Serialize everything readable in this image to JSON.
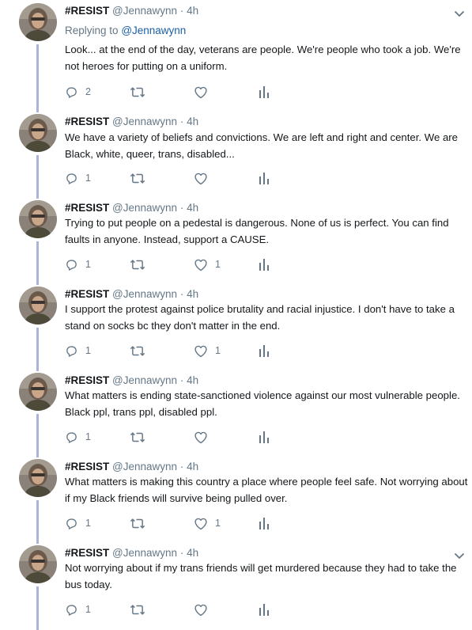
{
  "colors": {
    "text": "#14171a",
    "secondary": "#657786",
    "link": "#1b5fa8",
    "thread_line": "#aab3dc",
    "icon": "#657786"
  },
  "icons": {
    "reply": "speech-bubble",
    "retweet": "retweet-arrows",
    "like": "heart-outline",
    "analytics": "bar-chart",
    "more": "chevron-down"
  },
  "tweets": [
    {
      "display_name": "#RESIST",
      "handle": "@Jennawynn",
      "dot": "·",
      "time": "4h",
      "replying_label": "Replying to",
      "replying_to": "@Jennawynn",
      "text": "Look... at the end of the day, veterans are people. We're people who took a job. We're not heroes for putting on a uniform.",
      "reply_count": "2",
      "retweet_count": "",
      "like_count": ""
    },
    {
      "display_name": "#RESIST",
      "handle": "@Jennawynn",
      "dot": "·",
      "time": "4h",
      "text": "We have a variety of beliefs and convictions. We are left and right and center. We are Black, white, queer, trans, disabled...",
      "reply_count": "1",
      "retweet_count": "",
      "like_count": ""
    },
    {
      "display_name": "#RESIST",
      "handle": "@Jennawynn",
      "dot": "·",
      "time": "4h",
      "text": "Trying to put people on a pedestal is dangerous. None of us is perfect. You can find faults in anyone. Instead, support a CAUSE.",
      "reply_count": "1",
      "retweet_count": "",
      "like_count": "1"
    },
    {
      "display_name": "#RESIST",
      "handle": "@Jennawynn",
      "dot": "·",
      "time": "4h",
      "text": "I support the protest against police brutality and racial injustice. I don't have to take a stand on socks bc they don't matter in the end.",
      "reply_count": "1",
      "retweet_count": "",
      "like_count": "1"
    },
    {
      "display_name": "#RESIST",
      "handle": "@Jennawynn",
      "dot": "·",
      "time": "4h",
      "text": "What matters is ending state-sanctioned violence against our most vulnerable people. Black ppl, trans ppl, disabled ppl.",
      "reply_count": "1",
      "retweet_count": "",
      "like_count": ""
    },
    {
      "display_name": "#RESIST",
      "handle": "@Jennawynn",
      "dot": "·",
      "time": "4h",
      "text": "What matters is making this country a place where people feel safe. Not worrying about if my Black friends will survive being pulled over.",
      "reply_count": "1",
      "retweet_count": "",
      "like_count": "1"
    },
    {
      "display_name": "#RESIST",
      "handle": "@Jennawynn",
      "dot": "·",
      "time": "4h",
      "text": "Not worrying about if my trans friends will get murdered because they had to take the bus today.",
      "reply_count": "1",
      "retweet_count": "",
      "like_count": ""
    }
  ]
}
